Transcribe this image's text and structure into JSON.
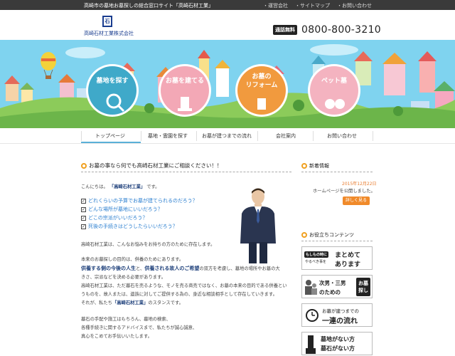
{
  "top_bar": {
    "tagline": "高崎市の墓地お墓探しの総合窓口サイト「高崎石材工業」",
    "links": [
      "・運営会社",
      "・サイトマップ",
      "・お問い合わせ"
    ]
  },
  "header": {
    "logo_mark": "石",
    "logo_name": "高崎石材工業株式会社",
    "phone_badge": "通話無料",
    "phone_number": "0800-800-3210"
  },
  "hero": {
    "buttons": [
      {
        "label1": "墓地を探す",
        "label2": "",
        "color": "#3fa9c9"
      },
      {
        "label1": "お墓を建てる",
        "label2": "",
        "color": "#f3a8b6"
      },
      {
        "label1": "お墓の",
        "label2": "リフォーム",
        "color": "#f19a3e"
      },
      {
        "label1": "ペット墓",
        "label2": "",
        "color": "#f4b3c0"
      }
    ]
  },
  "nav": {
    "items": [
      "トップページ",
      "墓地・霊園を探す",
      "お墓が建つまでの流れ",
      "会社案内",
      "お問い合わせ"
    ]
  },
  "main": {
    "title": "お墓の事なら何でも高崎石材工業にご相談ください！！",
    "greeting_pre": "こんにちは。",
    "greeting_name": "「高崎石材工業」",
    "greeting_post": "です。",
    "questions": [
      "どれくらいの予算でお墓が建てられるのだろう？",
      "どんな場所が墓地にいいだろう？",
      "どこの宗派がいいだろう？",
      "死後の手続きはどうしたらいいだろう？"
    ],
    "p1": "高崎石材工業は、こんなお悩みをお持ちの方のために存在します。",
    "p2": "本来のお墓探しの目的は、供養のためにあります。",
    "p3_a": "供養する側の今後の人生",
    "p3_b": "と、",
    "p3_c": "供養される故人のご希望",
    "p3_d": "の双方を考慮し、墓地の場所やお墓の大",
    "p4": "きさ、宗派などを決める必要があります。",
    "p5": "高崎石材工業は、ただ墓石を売るような、モノを売る商売ではなく、お墓の本来の目的である供養とい",
    "p6": "うものを、故人または、遺族に対してご提供する為の、身近な相談相手として存在していきます。",
    "p7_pre": "それが、私たち",
    "p7_name": "「高崎石材工業」",
    "p7_post": "のスタンスです。",
    "p8": "墓石の手配や施工はもちろん、墓地の検索、",
    "p9": "各種手続きに関するアドバイスまで、私たちが誠心誠意、",
    "p10": "真心をこめてお手伝いいたします。"
  },
  "side": {
    "news_title": "新着情報",
    "news_date": "2015年12月22日",
    "news_text": "ホームページを公開しました。",
    "news_more": "詳しく見る",
    "contents_title": "お役立ちコンテンツ",
    "banner1_tag": "もしもの時に",
    "banner1_tag2": "やるべき事を",
    "banner1_l1": "まとめて",
    "banner1_l2": "あります",
    "banner2_l1": "次男・三男",
    "banner2_l2": "のための",
    "banner2_box": "お墓",
    "banner2_box2": "探し",
    "banner3_l1": "お墓が建つまでの",
    "banner3_l2": "一連の流れ",
    "banner4_l1": "墓地がない方",
    "banner4_l2": "墓石がない方"
  },
  "colors": {
    "accent_orange": "#f08a2a",
    "link_blue": "#2b7fd0",
    "sky": "#7fd3ef"
  }
}
